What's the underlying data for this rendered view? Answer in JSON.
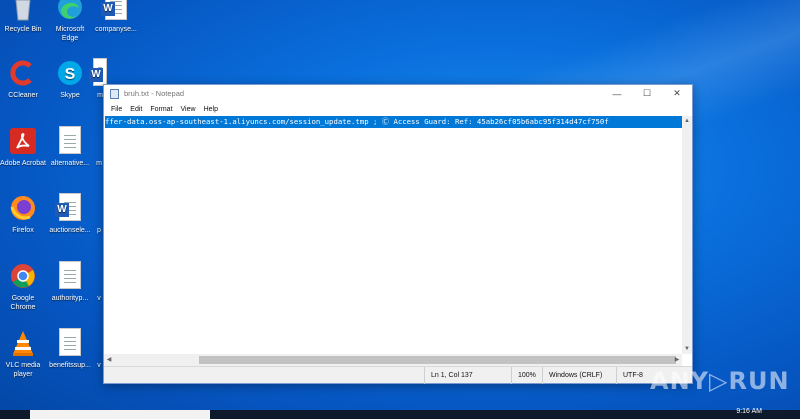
{
  "desktop": {
    "icons": [
      {
        "label": "Recycle Bin",
        "icon": "recycle-bin-icon"
      },
      {
        "label": "Microsoft Edge",
        "icon": "edge-icon"
      },
      {
        "label": "companyse...",
        "icon": "word-doc-icon"
      },
      {
        "label": "CCleaner",
        "icon": "ccleaner-icon"
      },
      {
        "label": "Skype",
        "icon": "skype-icon"
      },
      {
        "label": "m",
        "icon": "word-doc-icon"
      },
      {
        "label": "Adobe Acrobat",
        "icon": "acrobat-icon"
      },
      {
        "label": "alternative...",
        "icon": "text-doc-icon"
      },
      {
        "label": "m",
        "icon": "text-doc-icon"
      },
      {
        "label": "Firefox",
        "icon": "firefox-icon"
      },
      {
        "label": "auctionsele...",
        "icon": "word-doc-icon"
      },
      {
        "label": "p",
        "icon": "text-doc-icon"
      },
      {
        "label": "Google Chrome",
        "icon": "chrome-icon"
      },
      {
        "label": "authorityp...",
        "icon": "text-doc-icon"
      },
      {
        "label": "v",
        "icon": "text-doc-icon"
      },
      {
        "label": "VLC media player",
        "icon": "vlc-icon"
      },
      {
        "label": "benefitssup...",
        "icon": "text-doc-icon"
      },
      {
        "label": "v",
        "icon": "text-doc-icon"
      }
    ]
  },
  "notepad": {
    "title": "bruh.txt - Notepad",
    "menu": [
      "File",
      "Edit",
      "Format",
      "View",
      "Help"
    ],
    "content": "ffer-data.oss-ap-southeast-1.aliyuncs.com/session_update.tmp ; Ⓒ Access Guard: Ref: 45ab26cf05b6abc95f314d47cf750f",
    "status": {
      "position": "Ln 1, Col 137",
      "zoom": "100%",
      "line_endings": "Windows (CRLF)",
      "encoding": "UTF-8"
    }
  },
  "taskbar": {
    "time": "9:16 AM"
  },
  "watermark": "ANY▷RUN",
  "colors": {
    "desktop": "#0a6fdc",
    "selection": "#0078d7",
    "taskbar": "#0e1a2b"
  }
}
